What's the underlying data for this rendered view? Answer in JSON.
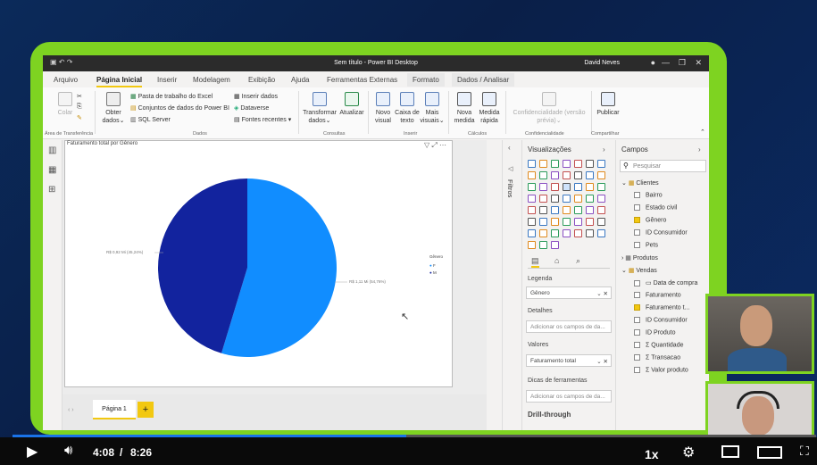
{
  "window": {
    "title": "Sem título - Power BI Desktop",
    "user": "David Neves"
  },
  "tabs": [
    {
      "label": "Arquivo"
    },
    {
      "label": "Página Inicial"
    },
    {
      "label": "Inserir"
    },
    {
      "label": "Modelagem"
    },
    {
      "label": "Exibição"
    },
    {
      "label": "Ajuda"
    },
    {
      "label": "Ferramentas Externas"
    },
    {
      "label": "Formato"
    },
    {
      "label": "Dados / Analisar"
    }
  ],
  "ribbon": {
    "paste": "Colar",
    "get_data": "Obter",
    "get_data2": "dados",
    "excel": "Pasta de trabalho do Excel",
    "datasets": "Conjuntos de dados do Power BI",
    "sql": "SQL Server",
    "enter_data": "Inserir dados",
    "dataverse": "Dataverse",
    "recent": "Fontes recentes",
    "transform": "Transformar",
    "transform2": "dados",
    "refresh": "Atualizar",
    "new_visual": "Novo",
    "new_visual2": "visual",
    "textbox": "Caixa de",
    "textbox2": "texto",
    "more": "Mais",
    "more2": "visuais",
    "new_measure": "Nova",
    "new_measure2": "medida",
    "quick": "Medida",
    "quick2": "rápida",
    "sensitivity": "Confidencialidade (versão",
    "sensitivity2": "prévia)",
    "publish": "Publicar",
    "groups": {
      "clipboard": "Área de Transferência",
      "data": "Dados",
      "queries": "Consultas",
      "insert": "Inserir",
      "calc": "Cálculos",
      "sens": "Confidencialidade",
      "share": "Compartilhar"
    }
  },
  "visual": {
    "title": "Faturamento total por Gênero",
    "label_m": "R$ 0,92 Mi (45,24%)",
    "label_f": "R$ 1,11 Mi (54,76%)",
    "legend_title": "Gênero",
    "legend_f": "F",
    "legend_m": "M"
  },
  "chart_data": {
    "type": "pie",
    "title": "Faturamento total por Gênero",
    "categories": [
      "F",
      "M"
    ],
    "values": [
      1.11,
      0.92
    ],
    "percent": [
      54.76,
      45.24
    ],
    "colors": [
      "#118dff",
      "#12239e"
    ]
  },
  "page": {
    "tab": "Página 1",
    "add": "+"
  },
  "filters": {
    "label": "Filtros"
  },
  "viz": {
    "title": "Visualizações",
    "legend": "Legenda",
    "legend_val": "Gênero",
    "details": "Detalhes",
    "details_ph": "Adicionar os campos de da...",
    "values": "Valores",
    "values_val": "Faturamento total",
    "tooltips": "Dicas de ferramentas",
    "tooltips_ph": "Adicionar os campos de da...",
    "drill": "Drill-through"
  },
  "fields": {
    "title": "Campos",
    "search_ph": "Pesquisar",
    "items": [
      "Clientes",
      "Bairro",
      "Estado civil",
      "Gênero",
      "ID Consumidor",
      "Pets",
      "Produtos",
      "Vendas",
      "Data de compra",
      "Faturamento",
      "Faturamento t...",
      "ID Consumidor",
      "ID Produto",
      "Quantidade",
      "Transacao",
      "Valor produto"
    ]
  },
  "player": {
    "time": "4:08",
    "sep": "/",
    "duration": "8:26",
    "speed": "1x",
    "progress": 0.49
  }
}
